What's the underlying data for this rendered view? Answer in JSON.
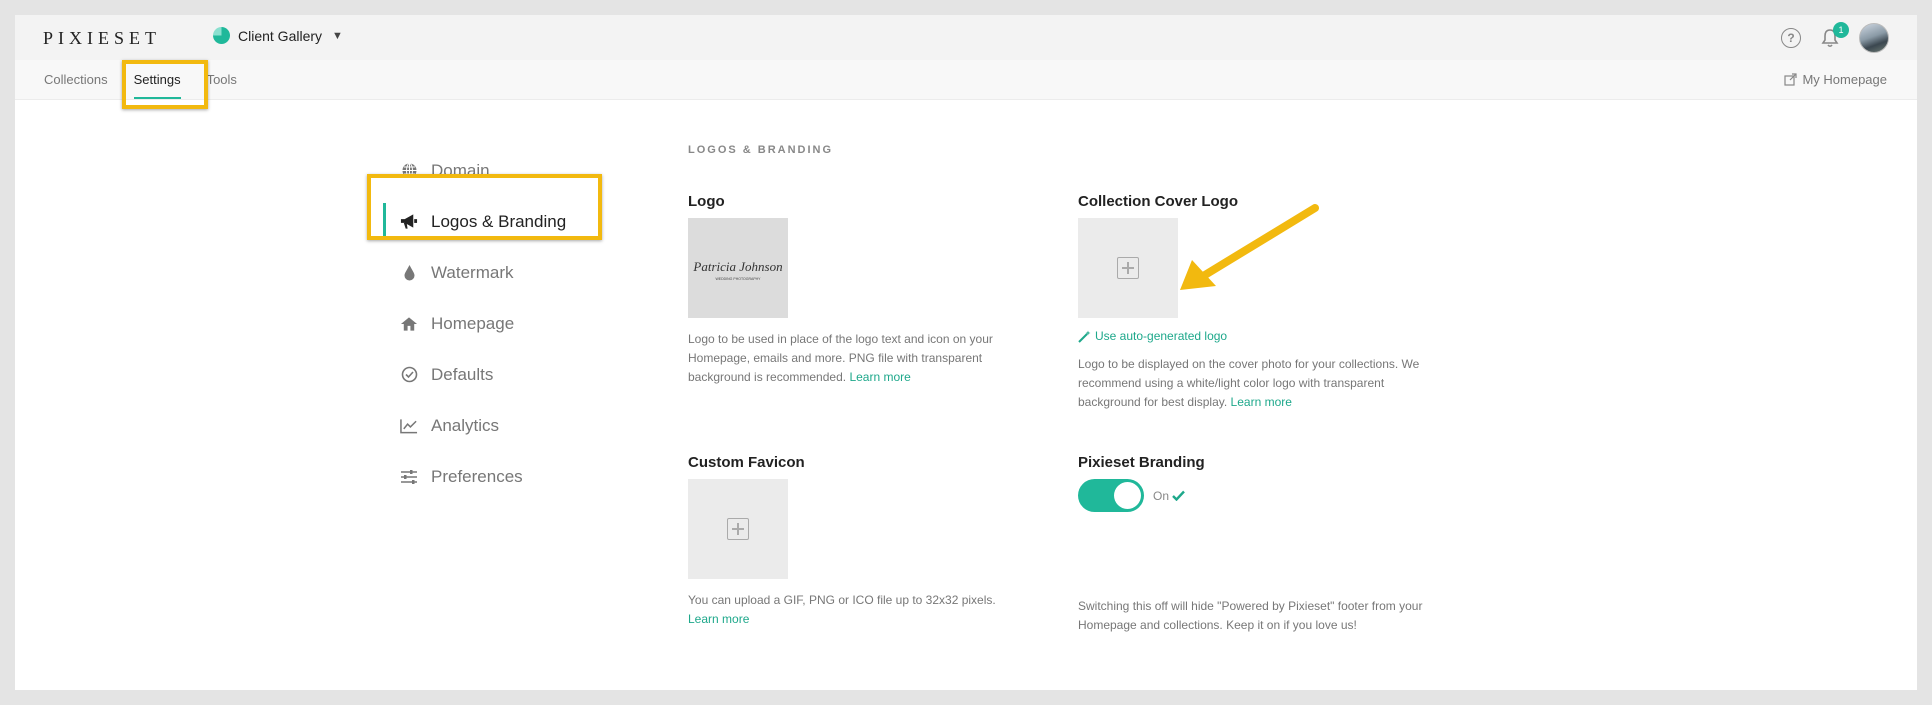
{
  "header": {
    "brand": "PIXIESET",
    "gallery_switch": "Client Gallery",
    "notification_count": "1"
  },
  "subnav": {
    "tabs": [
      {
        "label": "Collections"
      },
      {
        "label": "Settings",
        "active": true
      },
      {
        "label": "Tools"
      }
    ],
    "my_homepage": "My Homepage"
  },
  "sidebar": {
    "items": [
      {
        "label": "Domain",
        "icon": "globe-icon"
      },
      {
        "label": "Logos & Branding",
        "icon": "megaphone-icon",
        "active": true
      },
      {
        "label": "Watermark",
        "icon": "drop-icon"
      },
      {
        "label": "Homepage",
        "icon": "home-icon"
      },
      {
        "label": "Defaults",
        "icon": "check-circle-icon"
      },
      {
        "label": "Analytics",
        "icon": "chart-line-icon"
      },
      {
        "label": "Preferences",
        "icon": "sliders-icon"
      }
    ]
  },
  "content": {
    "section_title": "LOGOS & BRANDING",
    "logo": {
      "title": "Logo",
      "signature_text": "Patricia Johnson",
      "signature_caption": "WEDDING PHOTOGRAPHY",
      "description": "Logo to be used in place of the logo text and icon on your Homepage, emails and more. PNG file with transparent background is recommended.",
      "learn_more": "Learn more"
    },
    "cover_logo": {
      "title": "Collection Cover Logo",
      "autogen_link": "Use auto-generated logo",
      "description": "Logo to be displayed on the cover photo for your collections. We recommend using a white/light color logo with transparent background for best display.",
      "learn_more": "Learn more"
    },
    "favicon": {
      "title": "Custom Favicon",
      "description": "You can upload a GIF, PNG or ICO file up to 32x32 pixels.",
      "learn_more": "Learn more"
    },
    "branding": {
      "title": "Pixieset Branding",
      "toggle_state": "On",
      "description": "Switching this off will hide \"Powered by Pixieset\" footer from your Homepage and collections. Keep it on if you love us!"
    }
  },
  "colors": {
    "accent": "#20b89a",
    "highlight": "#f2b90f"
  }
}
